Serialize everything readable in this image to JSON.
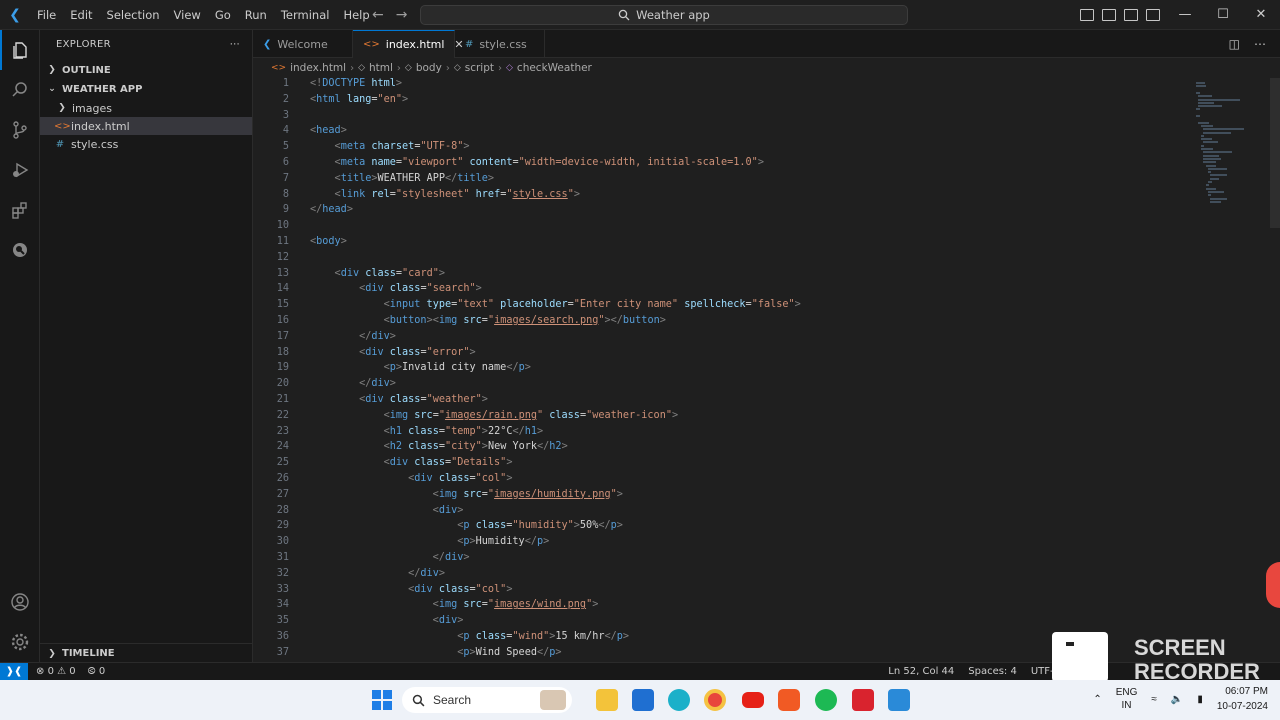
{
  "app": {
    "menu": [
      "File",
      "Edit",
      "Selection",
      "View",
      "Go",
      "Run",
      "Terminal",
      "Help"
    ],
    "search_title": "Weather app"
  },
  "sidebar": {
    "header": "EXPLORER",
    "outline": "OUTLINE",
    "project": "WEATHER APP",
    "items": [
      {
        "label": "images",
        "type": "folder"
      },
      {
        "label": "index.html",
        "type": "html"
      },
      {
        "label": "style.css",
        "type": "css"
      }
    ],
    "timeline": "TIMELINE"
  },
  "tabs": [
    {
      "label": "Welcome"
    },
    {
      "label": "index.html"
    },
    {
      "label": "style.css"
    }
  ],
  "breadcrumb": [
    "index.html",
    "html",
    "body",
    "script",
    "checkWeather"
  ],
  "status": {
    "errors": "0",
    "warnings": "0",
    "ports": "0",
    "position": "Ln 52, Col 44",
    "spaces": "Spaces: 4",
    "encoding": "UTF-8"
  },
  "overlay": {
    "recorder_line1": "SCREEN",
    "recorder_line2": "RECORDER"
  },
  "taskbar": {
    "search": "Search",
    "lang1": "ENG",
    "lang2": "IN",
    "time": "06:07 PM",
    "date": "10-07-2024"
  },
  "code_lines": [
    [
      [
        "tg",
        "<!"
      ],
      [
        "tn",
        "DOCTYPE"
      ],
      [
        "at",
        " html"
      ],
      [
        "tg",
        ">"
      ]
    ],
    [
      [
        "tg",
        "<"
      ],
      [
        "tn",
        "html"
      ],
      [
        "at",
        " lang"
      ],
      [
        "tx",
        "="
      ],
      [
        "st",
        "\"en\""
      ],
      [
        "tg",
        ">"
      ]
    ],
    [],
    [
      [
        "tg",
        "<"
      ],
      [
        "tn",
        "head"
      ],
      [
        "tg",
        ">"
      ]
    ],
    [
      [
        "tx",
        "    "
      ],
      [
        "tg",
        "<"
      ],
      [
        "tn",
        "meta"
      ],
      [
        "at",
        " charset"
      ],
      [
        "tx",
        "="
      ],
      [
        "st",
        "\"UTF-8\""
      ],
      [
        "tg",
        ">"
      ]
    ],
    [
      [
        "tx",
        "    "
      ],
      [
        "tg",
        "<"
      ],
      [
        "tn",
        "meta"
      ],
      [
        "at",
        " name"
      ],
      [
        "tx",
        "="
      ],
      [
        "st",
        "\"viewport\""
      ],
      [
        "at",
        " content"
      ],
      [
        "tx",
        "="
      ],
      [
        "st",
        "\"width=device-width, initial-scale=1.0\""
      ],
      [
        "tg",
        ">"
      ]
    ],
    [
      [
        "tx",
        "    "
      ],
      [
        "tg",
        "<"
      ],
      [
        "tn",
        "title"
      ],
      [
        "tg",
        ">"
      ],
      [
        "tx",
        "WEATHER APP"
      ],
      [
        "tg",
        "</"
      ],
      [
        "tn",
        "title"
      ],
      [
        "tg",
        ">"
      ]
    ],
    [
      [
        "tx",
        "    "
      ],
      [
        "tg",
        "<"
      ],
      [
        "tn",
        "link"
      ],
      [
        "at",
        " rel"
      ],
      [
        "tx",
        "="
      ],
      [
        "st",
        "\"stylesheet\""
      ],
      [
        "at",
        " href"
      ],
      [
        "tx",
        "="
      ],
      [
        "st",
        "\""
      ],
      [
        "stl",
        "style.css"
      ],
      [
        "st",
        "\""
      ],
      [
        "tg",
        ">"
      ]
    ],
    [
      [
        "tg",
        "</"
      ],
      [
        "tn",
        "head"
      ],
      [
        "tg",
        ">"
      ]
    ],
    [],
    [
      [
        "tg",
        "<"
      ],
      [
        "tn",
        "body"
      ],
      [
        "tg",
        ">"
      ]
    ],
    [],
    [
      [
        "tx",
        "    "
      ],
      [
        "tg",
        "<"
      ],
      [
        "tn",
        "div"
      ],
      [
        "at",
        " class"
      ],
      [
        "tx",
        "="
      ],
      [
        "st",
        "\"card\""
      ],
      [
        "tg",
        ">"
      ]
    ],
    [
      [
        "tx",
        "        "
      ],
      [
        "tg",
        "<"
      ],
      [
        "tn",
        "div"
      ],
      [
        "at",
        " class"
      ],
      [
        "tx",
        "="
      ],
      [
        "st",
        "\"search\""
      ],
      [
        "tg",
        ">"
      ]
    ],
    [
      [
        "tx",
        "            "
      ],
      [
        "tg",
        "<"
      ],
      [
        "tn",
        "input"
      ],
      [
        "at",
        " type"
      ],
      [
        "tx",
        "="
      ],
      [
        "st",
        "\"text\""
      ],
      [
        "at",
        " placeholder"
      ],
      [
        "tx",
        "="
      ],
      [
        "st",
        "\"Enter city name\""
      ],
      [
        "at",
        " spellcheck"
      ],
      [
        "tx",
        "="
      ],
      [
        "st",
        "\"false\""
      ],
      [
        "tg",
        ">"
      ]
    ],
    [
      [
        "tx",
        "            "
      ],
      [
        "tg",
        "<"
      ],
      [
        "tn",
        "button"
      ],
      [
        "tg",
        "><"
      ],
      [
        "tn",
        "img"
      ],
      [
        "at",
        " src"
      ],
      [
        "tx",
        "="
      ],
      [
        "st",
        "\""
      ],
      [
        "stl",
        "images/search.png"
      ],
      [
        "st",
        "\""
      ],
      [
        "tg",
        "></"
      ],
      [
        "tn",
        "button"
      ],
      [
        "tg",
        ">"
      ]
    ],
    [
      [
        "tx",
        "        "
      ],
      [
        "tg",
        "</"
      ],
      [
        "tn",
        "div"
      ],
      [
        "tg",
        ">"
      ]
    ],
    [
      [
        "tx",
        "        "
      ],
      [
        "tg",
        "<"
      ],
      [
        "tn",
        "div"
      ],
      [
        "at",
        " class"
      ],
      [
        "tx",
        "="
      ],
      [
        "st",
        "\"error\""
      ],
      [
        "tg",
        ">"
      ]
    ],
    [
      [
        "tx",
        "            "
      ],
      [
        "tg",
        "<"
      ],
      [
        "tn",
        "p"
      ],
      [
        "tg",
        ">"
      ],
      [
        "tx",
        "Invalid city name"
      ],
      [
        "tg",
        "</"
      ],
      [
        "tn",
        "p"
      ],
      [
        "tg",
        ">"
      ]
    ],
    [
      [
        "tx",
        "        "
      ],
      [
        "tg",
        "</"
      ],
      [
        "tn",
        "div"
      ],
      [
        "tg",
        ">"
      ]
    ],
    [
      [
        "tx",
        "        "
      ],
      [
        "tg",
        "<"
      ],
      [
        "tn",
        "div"
      ],
      [
        "at",
        " class"
      ],
      [
        "tx",
        "="
      ],
      [
        "st",
        "\"weather\""
      ],
      [
        "tg",
        ">"
      ]
    ],
    [
      [
        "tx",
        "            "
      ],
      [
        "tg",
        "<"
      ],
      [
        "tn",
        "img"
      ],
      [
        "at",
        " src"
      ],
      [
        "tx",
        "="
      ],
      [
        "st",
        "\""
      ],
      [
        "stl",
        "images/rain.png"
      ],
      [
        "st",
        "\""
      ],
      [
        "at",
        " class"
      ],
      [
        "tx",
        "="
      ],
      [
        "st",
        "\"weather-icon\""
      ],
      [
        "tg",
        ">"
      ]
    ],
    [
      [
        "tx",
        "            "
      ],
      [
        "tg",
        "<"
      ],
      [
        "tn",
        "h1"
      ],
      [
        "at",
        " class"
      ],
      [
        "tx",
        "="
      ],
      [
        "st",
        "\"temp\""
      ],
      [
        "tg",
        ">"
      ],
      [
        "tx",
        "22°C"
      ],
      [
        "tg",
        "</"
      ],
      [
        "tn",
        "h1"
      ],
      [
        "tg",
        ">"
      ]
    ],
    [
      [
        "tx",
        "            "
      ],
      [
        "tg",
        "<"
      ],
      [
        "tn",
        "h2"
      ],
      [
        "at",
        " class"
      ],
      [
        "tx",
        "="
      ],
      [
        "st",
        "\"city\""
      ],
      [
        "tg",
        ">"
      ],
      [
        "tx",
        "New York"
      ],
      [
        "tg",
        "</"
      ],
      [
        "tn",
        "h2"
      ],
      [
        "tg",
        ">"
      ]
    ],
    [
      [
        "tx",
        "            "
      ],
      [
        "tg",
        "<"
      ],
      [
        "tn",
        "div"
      ],
      [
        "at",
        " class"
      ],
      [
        "tx",
        "="
      ],
      [
        "st",
        "\"Details\""
      ],
      [
        "tg",
        ">"
      ]
    ],
    [
      [
        "tx",
        "                "
      ],
      [
        "tg",
        "<"
      ],
      [
        "tn",
        "div"
      ],
      [
        "at",
        " class"
      ],
      [
        "tx",
        "="
      ],
      [
        "st",
        "\"col\""
      ],
      [
        "tg",
        ">"
      ]
    ],
    [
      [
        "tx",
        "                    "
      ],
      [
        "tg",
        "<"
      ],
      [
        "tn",
        "img"
      ],
      [
        "at",
        " src"
      ],
      [
        "tx",
        "="
      ],
      [
        "st",
        "\""
      ],
      [
        "stl",
        "images/humidity.png"
      ],
      [
        "st",
        "\""
      ],
      [
        "tg",
        ">"
      ]
    ],
    [
      [
        "tx",
        "                    "
      ],
      [
        "tg",
        "<"
      ],
      [
        "tn",
        "div"
      ],
      [
        "tg",
        ">"
      ]
    ],
    [
      [
        "tx",
        "                        "
      ],
      [
        "tg",
        "<"
      ],
      [
        "tn",
        "p"
      ],
      [
        "at",
        " class"
      ],
      [
        "tx",
        "="
      ],
      [
        "st",
        "\"humidity\""
      ],
      [
        "tg",
        ">"
      ],
      [
        "tx",
        "50%"
      ],
      [
        "tg",
        "</"
      ],
      [
        "tn",
        "p"
      ],
      [
        "tg",
        ">"
      ]
    ],
    [
      [
        "tx",
        "                        "
      ],
      [
        "tg",
        "<"
      ],
      [
        "tn",
        "p"
      ],
      [
        "tg",
        ">"
      ],
      [
        "tx",
        "Humidity"
      ],
      [
        "tg",
        "</"
      ],
      [
        "tn",
        "p"
      ],
      [
        "tg",
        ">"
      ]
    ],
    [
      [
        "tx",
        "                    "
      ],
      [
        "tg",
        "</"
      ],
      [
        "tn",
        "div"
      ],
      [
        "tg",
        ">"
      ]
    ],
    [
      [
        "tx",
        "                "
      ],
      [
        "tg",
        "</"
      ],
      [
        "tn",
        "div"
      ],
      [
        "tg",
        ">"
      ]
    ],
    [
      [
        "tx",
        "                "
      ],
      [
        "tg",
        "<"
      ],
      [
        "tn",
        "div"
      ],
      [
        "at",
        " class"
      ],
      [
        "tx",
        "="
      ],
      [
        "st",
        "\"col\""
      ],
      [
        "tg",
        ">"
      ]
    ],
    [
      [
        "tx",
        "                    "
      ],
      [
        "tg",
        "<"
      ],
      [
        "tn",
        "img"
      ],
      [
        "at",
        " src"
      ],
      [
        "tx",
        "="
      ],
      [
        "st",
        "\""
      ],
      [
        "stl",
        "images/wind.png"
      ],
      [
        "st",
        "\""
      ],
      [
        "tg",
        ">"
      ]
    ],
    [
      [
        "tx",
        "                    "
      ],
      [
        "tg",
        "<"
      ],
      [
        "tn",
        "div"
      ],
      [
        "tg",
        ">"
      ]
    ],
    [
      [
        "tx",
        "                        "
      ],
      [
        "tg",
        "<"
      ],
      [
        "tn",
        "p"
      ],
      [
        "at",
        " class"
      ],
      [
        "tx",
        "="
      ],
      [
        "st",
        "\"wind\""
      ],
      [
        "tg",
        ">"
      ],
      [
        "tx",
        "15 km/hr"
      ],
      [
        "tg",
        "</"
      ],
      [
        "tn",
        "p"
      ],
      [
        "tg",
        ">"
      ]
    ],
    [
      [
        "tx",
        "                        "
      ],
      [
        "tg",
        "<"
      ],
      [
        "tn",
        "p"
      ],
      [
        "tg",
        ">"
      ],
      [
        "tx",
        "Wind Speed"
      ],
      [
        "tg",
        "</"
      ],
      [
        "tn",
        "p"
      ],
      [
        "tg",
        ">"
      ]
    ]
  ]
}
